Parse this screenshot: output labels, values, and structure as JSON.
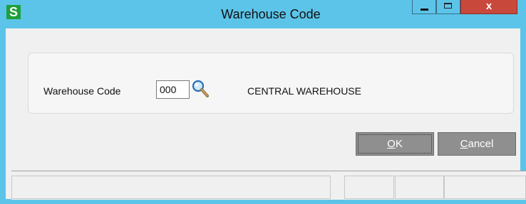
{
  "window": {
    "app_icon_letter": "S",
    "title": "Warehouse Code",
    "close_label": "x"
  },
  "form": {
    "warehouse_code_label": "Warehouse Code",
    "warehouse_code_value": "000",
    "warehouse_description": "CENTRAL WAREHOUSE"
  },
  "buttons": {
    "ok_label": "OK",
    "ok_mnemonic": "O",
    "ok_rest": "K",
    "cancel_mnemonic": "C",
    "cancel_rest": "ancel"
  },
  "icons": {
    "lookup": "magnifier-icon"
  }
}
